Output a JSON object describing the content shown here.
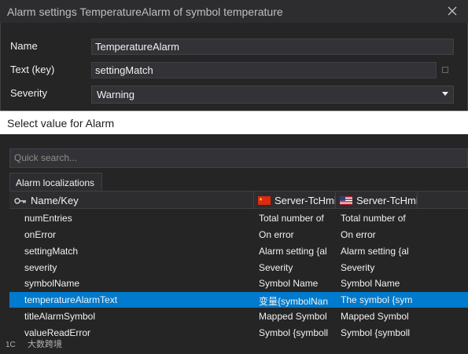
{
  "window": {
    "title": "Alarm settings TemperatureAlarm of symbol temperature"
  },
  "form": {
    "name_label": "Name",
    "name_value": "TemperatureAlarm",
    "text_label": "Text (key)",
    "text_value": "settingMatch",
    "severity_label": "Severity",
    "severity_value": "Warning"
  },
  "popup": {
    "title": "Select value for Alarm",
    "search_placeholder": "Quick search...",
    "tab_label": "Alarm localizations",
    "columns": [
      "Name/Key",
      "Server-TcHmi...",
      "Server-TcHmi..."
    ],
    "rows": [
      {
        "key": "numEntries",
        "zh": "Total number of",
        "en": "Total number of",
        "selected": false
      },
      {
        "key": "onError",
        "zh": "On error",
        "en": "On error",
        "selected": false
      },
      {
        "key": "settingMatch",
        "zh": "Alarm setting {al",
        "en": "Alarm setting {al",
        "selected": false
      },
      {
        "key": "severity",
        "zh": "Severity",
        "en": "Severity",
        "selected": false
      },
      {
        "key": "symbolName",
        "zh": "Symbol Name",
        "en": "Symbol Name",
        "selected": false
      },
      {
        "key": "temperatureAlarmText",
        "zh": "变量{symbolNan",
        "en": "The symbol {sym",
        "selected": true
      },
      {
        "key": "titleAlarmSymbol",
        "zh": "Mapped Symbol",
        "en": "Mapped Symbol",
        "selected": false
      },
      {
        "key": "valueReadError",
        "zh": "Symbol {symboll",
        "en": "Symbol {symboll",
        "selected": false
      }
    ]
  },
  "watermark": {
    "text": "大数跨境"
  },
  "colors": {
    "background": "#1e1e1e",
    "selection": "#007acc",
    "panel": "#252526"
  }
}
